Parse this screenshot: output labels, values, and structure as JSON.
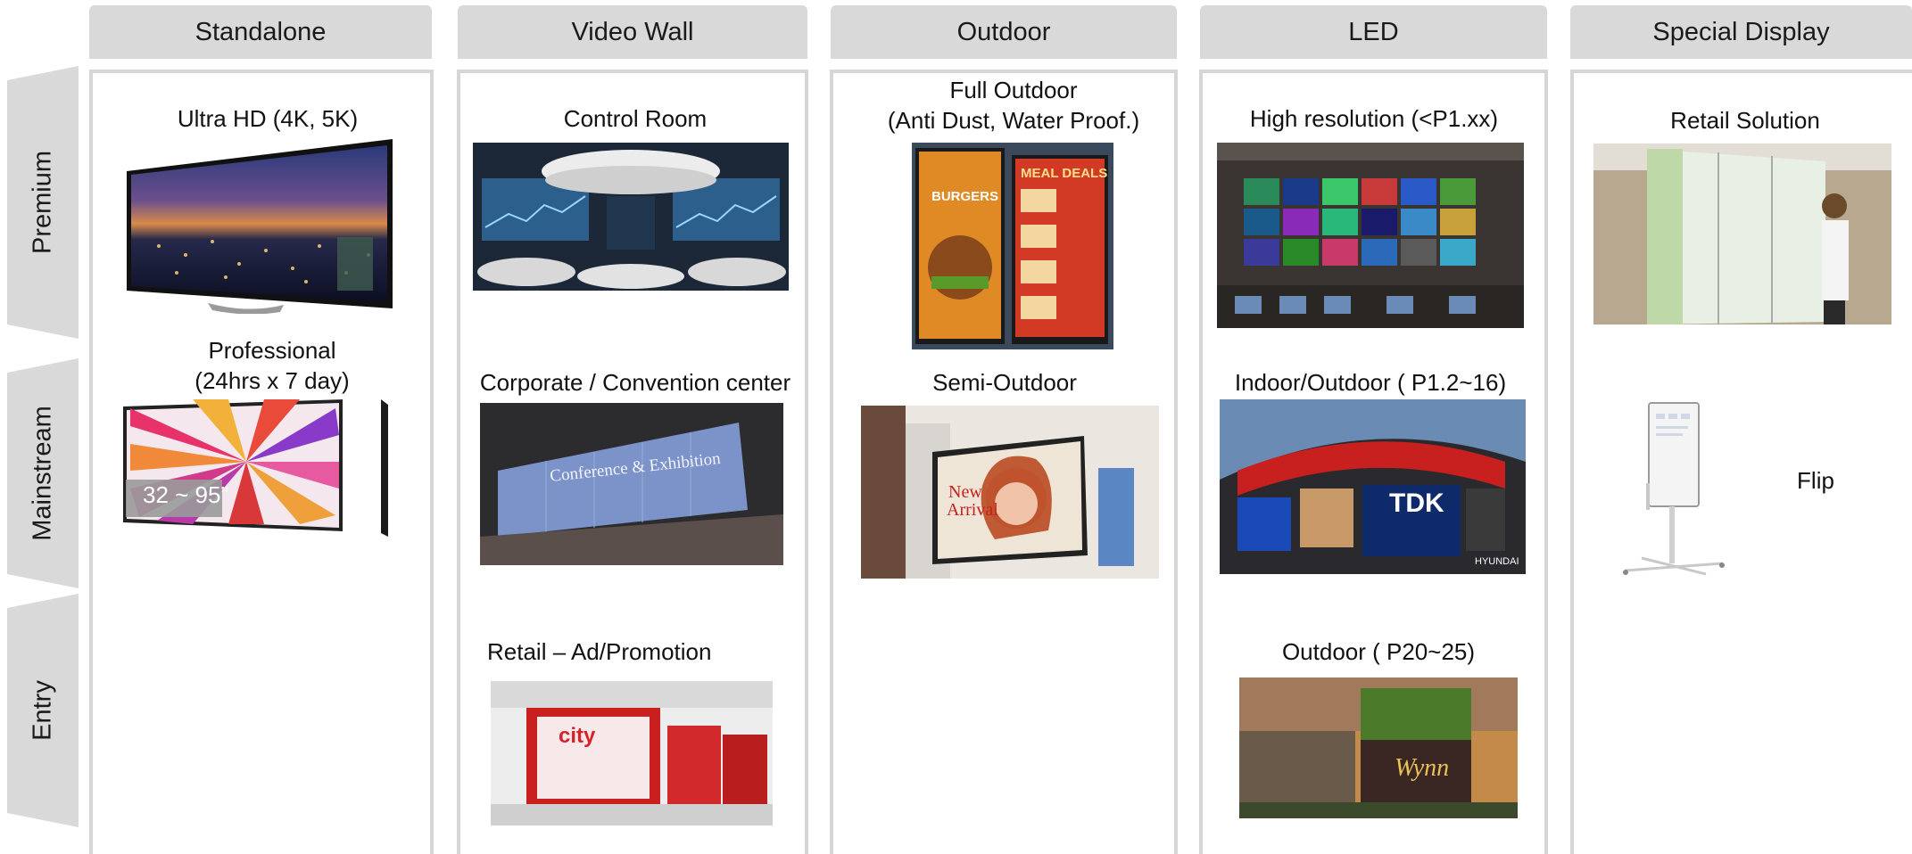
{
  "columns": {
    "standalone": "Standalone",
    "video_wall": "Video Wall",
    "outdoor": "Outdoor",
    "led": "LED",
    "special": "Special Display"
  },
  "rows": {
    "premium": "Premium",
    "mainstream": "Mainstream",
    "entry": "Entry"
  },
  "items": {
    "standalone_premium": "Ultra HD (4K, 5K)",
    "standalone_mainstream_1": "Professional",
    "standalone_mainstream_2": "(24hrs x 7 day)",
    "standalone_size_badge": "32 ~ 95”",
    "videowall_premium": "Control Room",
    "videowall_mainstream": "Corporate / Convention center",
    "videowall_entry": "Retail – Ad/Promotion",
    "videowall_conference_text": "Conference & Exhibition",
    "outdoor_premium_1": "Full Outdoor",
    "outdoor_premium_2": "(Anti Dust, Water Proof.)",
    "outdoor_mainstream": "Semi-Outdoor",
    "outdoor_burger_sign": "BURGERS",
    "outdoor_meal_sign": "MEAL DEALS",
    "outdoor_new_arrival_1": "New",
    "outdoor_new_arrival_2": "Arrival",
    "led_premium": "High resolution (<P1.xx)",
    "led_mainstream": "Indoor/Outdoor ( P1.2~16)",
    "led_entry": "Outdoor ( P20~25)",
    "led_tdk_sign": "TDK",
    "led_hyundai_sign": "HYUNDAI",
    "led_wynn_sign": "Wynn",
    "videowall_city_sign": "city",
    "special_premium": "Retail Solution",
    "special_mainstream": "Flip"
  }
}
